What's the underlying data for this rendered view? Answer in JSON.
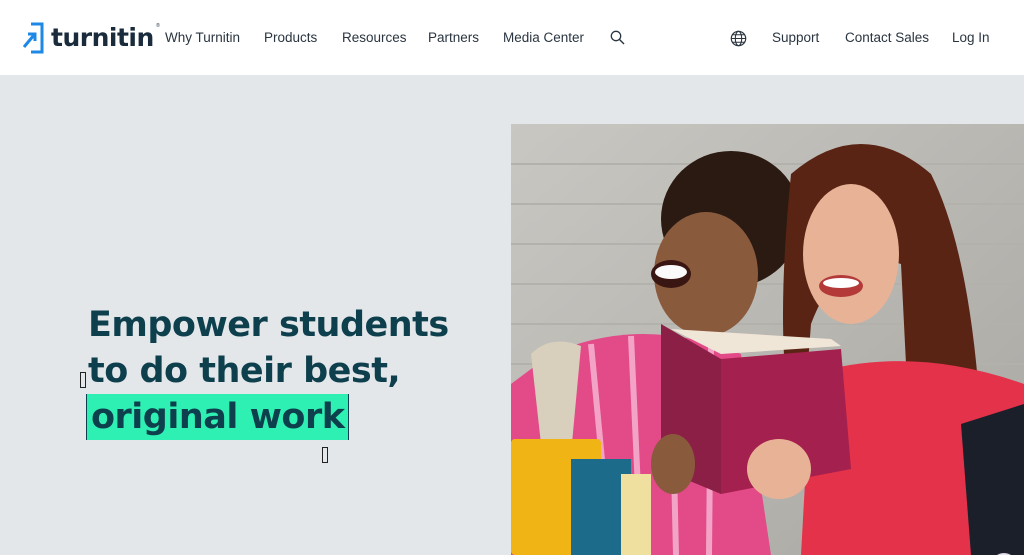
{
  "header": {
    "logo_text": "turnitin",
    "nav": [
      {
        "label": "Why Turnitin"
      },
      {
        "label": "Products"
      },
      {
        "label": "Resources"
      },
      {
        "label": "Partners"
      },
      {
        "label": "Media Center"
      }
    ],
    "right": {
      "support": "Support",
      "contact_sales": "Contact Sales",
      "login": "Log In"
    },
    "icons": {
      "search": "search-icon",
      "language": "globe-icon"
    }
  },
  "hero": {
    "line1": "Empower students",
    "line2": "to do their best,",
    "line3": "original work",
    "photo_alt": "two-students-laughing-reading-book",
    "translate_icon": "translate-icon"
  },
  "colors": {
    "brand_blue": "#1d88e5",
    "title": "#0e3f4d",
    "highlight": "#2ff0b3",
    "hero_bg": "#e3e7ea"
  }
}
